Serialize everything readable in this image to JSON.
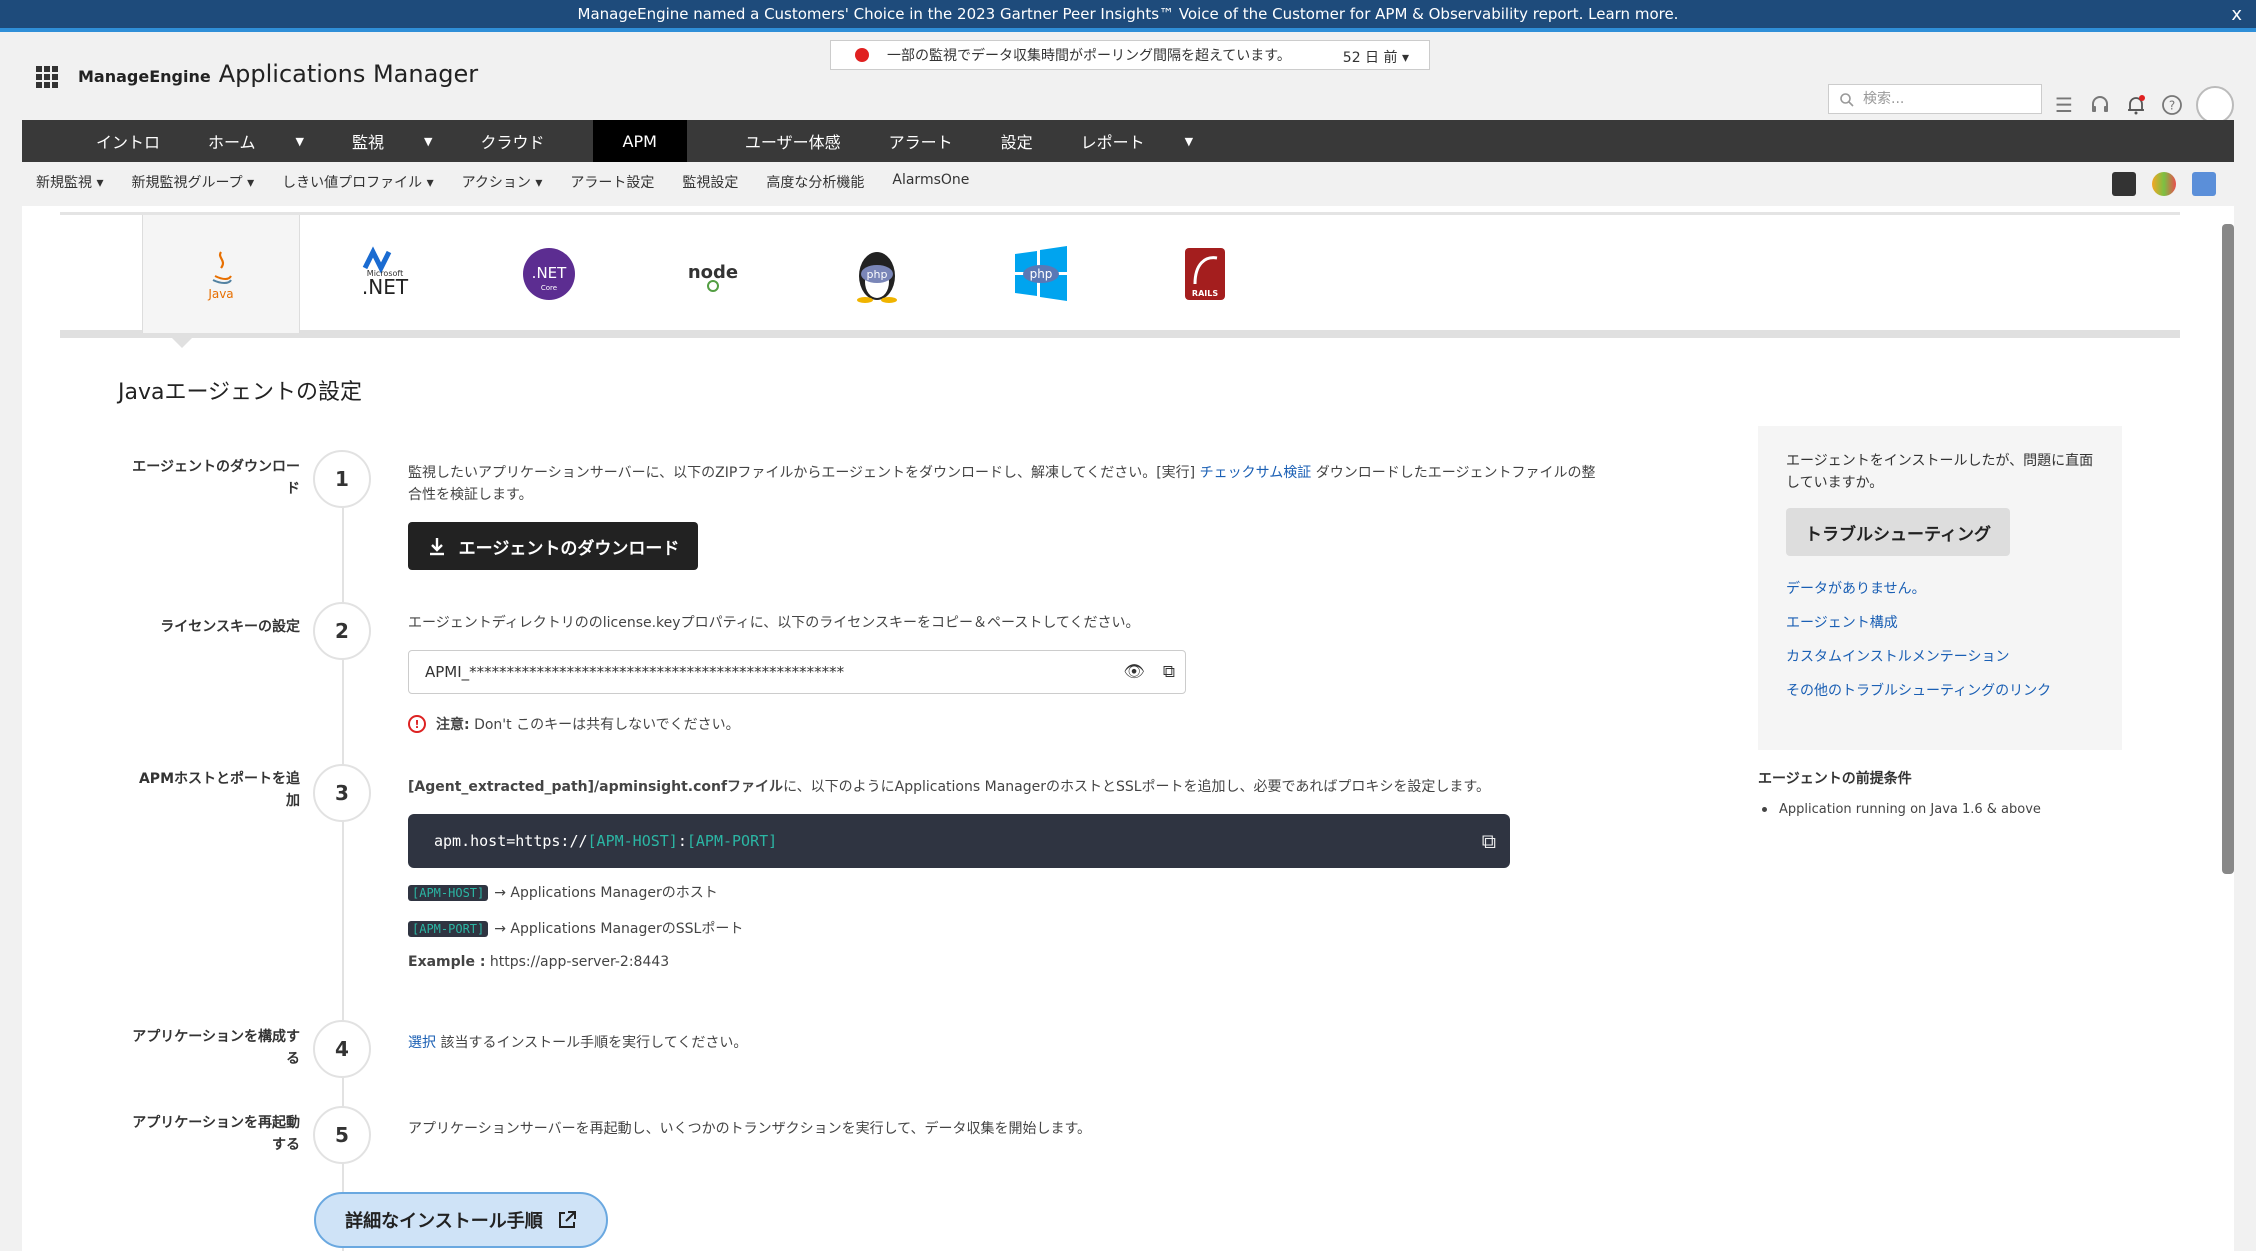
{
  "banner": {
    "text": "ManageEngine named a Customers' Choice in the 2023 Gartner Peer Insights™ Voice of the Customer for APM & Observability report. Learn more.",
    "close_label": "x"
  },
  "header": {
    "brand_small": "ManageEngine",
    "brand_app": "Applications Manager",
    "status_text": "一部の監視でデータ収集時間がポーリング間隔を超えています。",
    "status_time": "52 日 前 ▾",
    "search_placeholder": "検索..."
  },
  "mainnav": {
    "items": [
      {
        "label": "イントロ"
      },
      {
        "label": "ホーム"
      },
      {
        "label": "監視"
      },
      {
        "label": "クラウド"
      },
      {
        "label": "APM"
      },
      {
        "label": "ユーザー体感"
      },
      {
        "label": "アラート"
      },
      {
        "label": "設定"
      },
      {
        "label": "レポート"
      }
    ],
    "active": "APM"
  },
  "subnav": {
    "items": [
      {
        "label": "新規監視 ▾"
      },
      {
        "label": "新規監視グループ ▾"
      },
      {
        "label": "しきい値プロファイル ▾"
      },
      {
        "label": "アクション ▾"
      },
      {
        "label": "アラート設定"
      },
      {
        "label": "監視設定"
      },
      {
        "label": "高度な分析機能"
      },
      {
        "label": "AlarmsOne"
      }
    ]
  },
  "tabs": {
    "items": [
      {
        "label": "Java",
        "icon": "java-icon"
      },
      {
        "label": ".NET",
        "icon": "dotnet-icon",
        "sub": "Microsoft"
      },
      {
        "label": ".NET",
        "icon": "dotnet-core-icon",
        "sub": "Core"
      },
      {
        "label": "node",
        "icon": "nodejs-icon"
      },
      {
        "label": "php",
        "icon": "php-linux-icon"
      },
      {
        "label": "php",
        "icon": "php-windows-icon"
      },
      {
        "label": "RAILS",
        "icon": "rails-icon"
      }
    ]
  },
  "page": {
    "title": "Javaエージェントの設定"
  },
  "steps": {
    "s1": {
      "label": "エージェントのダウンロード",
      "num": "1",
      "text_a": "監視したいアプリケーションサーバーに、以下のZIPファイルからエージェントをダウンロードし、解凍してください。[実行]",
      "link": "チェックサム検証",
      "text_b": "ダウンロードしたエージェントファイルの整合性を検証します。",
      "button": "エージェントのダウンロード"
    },
    "s2": {
      "label": "ライセンスキーの設定",
      "num": "2",
      "text": "エージェントディレクトリののlicense.keyプロパティに、以下のライセンスキーをコピー＆ペーストしてください。",
      "license_value": "APMI_**************************************************",
      "note_bold": "注意:",
      "note_text": "Don't このキーは共有しないでください。"
    },
    "s3": {
      "label": "APMホストとポートを追加",
      "num": "3",
      "text_bold": "[Agent_extracted_path]/apminsight.confファイル",
      "text_rest": "に、以下のようにApplications ManagerのホストとSSLポートを追加し、必要であればプロキシを設定します。",
      "code_prefix": "apm.host=https://",
      "code_host": "[APM-HOST]",
      "code_sep": ":",
      "code_port": "[APM-PORT]",
      "host_tag": "[APM-HOST]",
      "host_desc": "→ Applications Managerのホスト",
      "port_tag": "[APM-PORT]",
      "port_desc": "→ Applications ManagerのSSLポート",
      "example_label": "Example :",
      "example_value": "https://app-server-2:8443"
    },
    "s4": {
      "label": "アプリケーションを構成する",
      "num": "4",
      "link": "選択",
      "text": "該当するインストール手順を実行してください。"
    },
    "s5": {
      "label": "アプリケーションを再起動する",
      "num": "5",
      "text": "アプリケーションサーバーを再起動し、いくつかのトランザクションを実行して、データ収集を開始します。"
    },
    "install_button": "詳細なインストール手順"
  },
  "help": {
    "question": "エージェントをインストールしたが、問題に直面していますか。",
    "button": "トラブルシューティング",
    "links": [
      "データがありません。",
      "エージェント構成",
      "カスタムインストルメンテーション",
      "その他のトラブルシューティングのリンク"
    ],
    "prereq_title": "エージェントの前提条件",
    "prereq_item": "Application running on Java 1.6 & above"
  },
  "colors": {
    "banner_bg": "#1e4b7b",
    "nav_bg": "#393939",
    "nav_active": "#000000",
    "link": "#1a5fb4",
    "code_bg": "#2f3441",
    "code_placeholder": "#2bb6a4"
  }
}
